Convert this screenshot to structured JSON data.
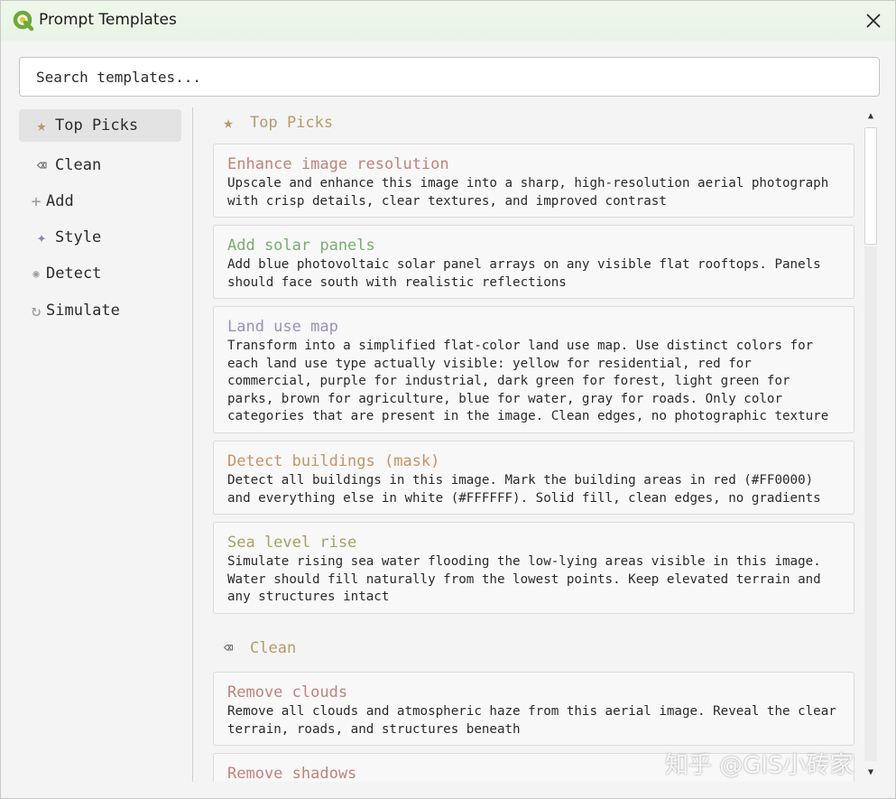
{
  "window": {
    "title": "Prompt Templates"
  },
  "search": {
    "placeholder": "Search templates..."
  },
  "sidebar": {
    "items": [
      {
        "label": "Top Picks",
        "icon": "★"
      },
      {
        "label": "Clean",
        "icon": "⌫"
      },
      {
        "label": "Add",
        "icon": "+"
      },
      {
        "label": "Style",
        "icon": "✦"
      },
      {
        "label": "Detect",
        "icon": "◉"
      },
      {
        "label": "Simulate",
        "icon": "↻"
      }
    ]
  },
  "sections": [
    {
      "title": "Top Picks",
      "icon": "★",
      "cards": [
        {
          "title": "Enhance image resolution",
          "desc": "Upscale and enhance this image into a sharp, high-resolution aerial photograph with crisp details, clear textures, and improved contrast",
          "color": "#c0837a"
        },
        {
          "title": "Add solar panels",
          "desc": "Add blue photovoltaic solar panel arrays on any visible flat rooftops. Panels should face south with realistic reflections",
          "color": "#7cab72"
        },
        {
          "title": "Land use map",
          "desc": "Transform into a simplified flat-color land use map. Use distinct colors for each land use type actually visible: yellow for residential, red for commercial, purple for industrial, dark green for forest, light green for parks, brown for agriculture, blue for water, gray for roads. Only color categories that are present in the image. Clean edges, no photographic texture",
          "color": "#9a90b6"
        },
        {
          "title": "Detect buildings (mask)",
          "desc": "Detect all buildings in this image. Mark the building areas in red (#FF0000) and everything else in white (#FFFFFF). Solid fill, clean edges, no gradients",
          "color": "#c4946a"
        },
        {
          "title": "Sea level rise",
          "desc": "Simulate rising sea water flooding the low-lying areas visible in this image. Water should fill naturally from the lowest points. Keep elevated terrain and any structures intact",
          "color": "#a8a062"
        }
      ]
    },
    {
      "title": "Clean",
      "icon": "⌫",
      "cards": [
        {
          "title": "Remove clouds",
          "desc": "Remove all clouds and atmospheric haze from this aerial image. Reveal the clear terrain, roads, and structures beneath",
          "color": "#c0837a"
        },
        {
          "title": "Remove shadows",
          "desc": "",
          "color": "#c0837a"
        }
      ]
    }
  ],
  "watermark": "知乎 @GIS小砖家",
  "colors": {
    "section_header": "#b89a6a",
    "icon_dim": "#9a9a9a",
    "style_icon": "#8c8cb0"
  }
}
